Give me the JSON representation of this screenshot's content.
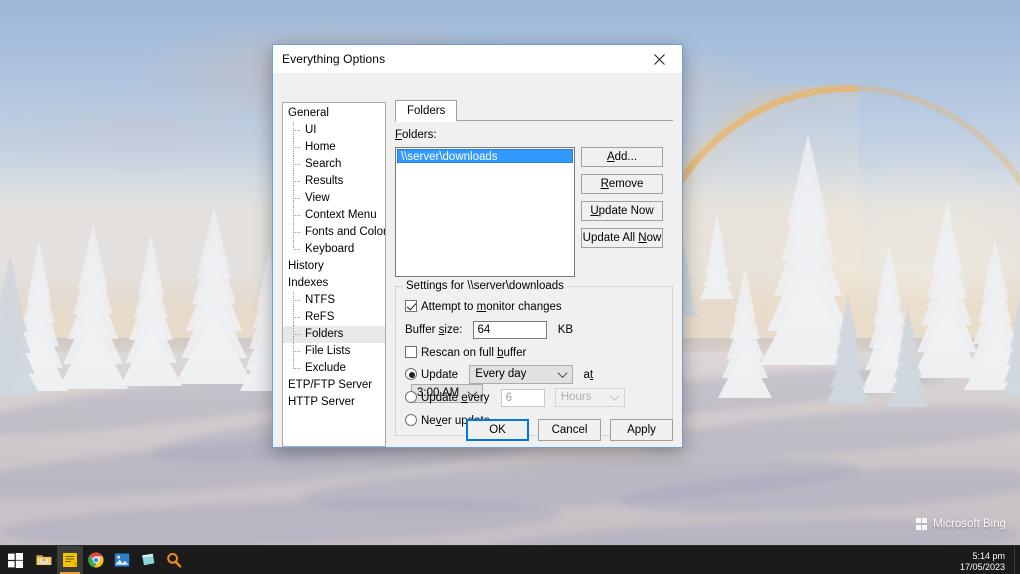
{
  "desktop": {
    "watermark": "Microsoft Bing",
    "watermark_icon": "bing-logo-icon"
  },
  "taskbar": {
    "start_icon": "windows-start-icon",
    "apps": [
      {
        "name": "file-explorer",
        "icon": "folder-icon",
        "active": false
      },
      {
        "name": "notepad",
        "icon": "notepad-icon",
        "active": true
      },
      {
        "name": "google-chrome",
        "icon": "chrome-icon",
        "active": false
      },
      {
        "name": "photos",
        "icon": "photos-icon",
        "active": false
      },
      {
        "name": "sticky-notes",
        "icon": "sticky-note-icon",
        "active": false
      },
      {
        "name": "everything-search",
        "icon": "magnifier-icon",
        "active": false
      }
    ],
    "clock": {
      "time": "5:14 pm",
      "date": "17/05/2023"
    }
  },
  "dialog": {
    "title": "Everything Options",
    "close_icon": "close-icon",
    "tree": [
      {
        "label": "General",
        "level": 0,
        "selected": false,
        "last": false
      },
      {
        "label": "UI",
        "level": 1,
        "selected": false,
        "last": false
      },
      {
        "label": "Home",
        "level": 1,
        "selected": false,
        "last": false
      },
      {
        "label": "Search",
        "level": 1,
        "selected": false,
        "last": false
      },
      {
        "label": "Results",
        "level": 1,
        "selected": false,
        "last": false
      },
      {
        "label": "View",
        "level": 1,
        "selected": false,
        "last": false
      },
      {
        "label": "Context Menu",
        "level": 1,
        "selected": false,
        "last": false
      },
      {
        "label": "Fonts and Colors",
        "level": 1,
        "selected": false,
        "last": false
      },
      {
        "label": "Keyboard",
        "level": 1,
        "selected": false,
        "last": true
      },
      {
        "label": "History",
        "level": 0,
        "selected": false,
        "last": false
      },
      {
        "label": "Indexes",
        "level": 0,
        "selected": false,
        "last": false
      },
      {
        "label": "NTFS",
        "level": 1,
        "selected": false,
        "last": false
      },
      {
        "label": "ReFS",
        "level": 1,
        "selected": false,
        "last": false
      },
      {
        "label": "Folders",
        "level": 1,
        "selected": true,
        "last": false
      },
      {
        "label": "File Lists",
        "level": 1,
        "selected": false,
        "last": false
      },
      {
        "label": "Exclude",
        "level": 1,
        "selected": false,
        "last": true
      },
      {
        "label": "ETP/FTP Server",
        "level": 0,
        "selected": false,
        "last": false
      },
      {
        "label": "HTTP Server",
        "level": 0,
        "selected": false,
        "last": false
      }
    ],
    "tab": {
      "label": "Folders"
    },
    "folders": {
      "list_label": "Folders:",
      "items": [
        "\\\\server\\downloads"
      ],
      "selected_index": 0,
      "buttons": [
        {
          "name": "add-button",
          "label": "Add...",
          "mnemonic": "A"
        },
        {
          "name": "remove-button",
          "label": "Remove",
          "mnemonic": "R"
        },
        {
          "name": "update-now-button",
          "label": "Update Now",
          "mnemonic": "U"
        },
        {
          "name": "update-all-now-button",
          "label": "Update All Now",
          "mnemonic": "N"
        }
      ]
    },
    "settings": {
      "legend": "Settings for \\\\server\\downloads",
      "monitor_changes": {
        "label": "Attempt to monitor changes",
        "checked": true
      },
      "buffer_size": {
        "label": "Buffer size:",
        "value": "64",
        "unit": "KB"
      },
      "rescan_on_full_buffer": {
        "label": "Rescan on full buffer",
        "checked": false
      },
      "update_schedule": {
        "label": "Update",
        "selected": true,
        "frequency_value": "Every day",
        "at_label": "at",
        "time_value": "3:00 AM"
      },
      "update_every": {
        "label": "Update every",
        "selected": false,
        "interval_value": "6",
        "unit_value": "Hours",
        "disabled": true
      },
      "never_update": {
        "label": "Never update",
        "selected": false
      }
    },
    "buttons": [
      {
        "name": "ok-button",
        "label": "OK",
        "default": true
      },
      {
        "name": "cancel-button",
        "label": "Cancel",
        "default": false
      },
      {
        "name": "apply-button",
        "label": "Apply",
        "default": false
      }
    ]
  },
  "colors": {
    "selection_blue": "#3399ff",
    "accent_blue": "#0078d7",
    "dialog_face": "#f0f0f0",
    "taskbar": "#1b1b1b"
  }
}
